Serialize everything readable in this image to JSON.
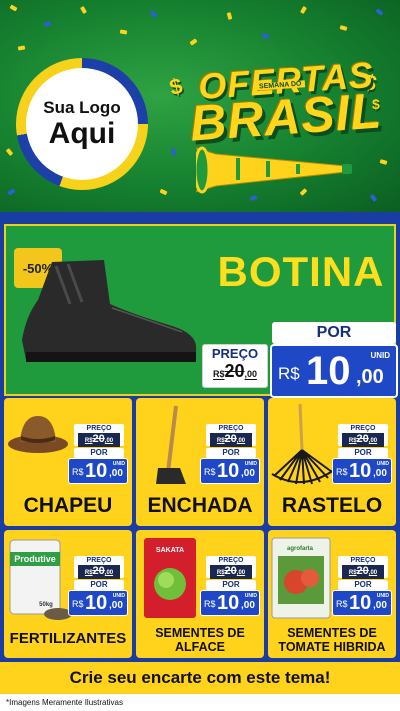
{
  "header": {
    "logo_line1": "Sua Logo",
    "logo_line2": "Aqui",
    "title_top": "OFERTAS",
    "title_small": "SEMANA DO",
    "title_bottom": "BRASIL",
    "dollar_sign": "$"
  },
  "featured": {
    "discount_badge": "-50%",
    "name": "BOTINA",
    "old_price_label": "PREÇO",
    "old_price_currency": "R$",
    "old_price_int": "20",
    "old_price_dec": ",00",
    "new_price_label": "POR",
    "new_price_currency": "R$",
    "new_price_int": "10",
    "new_price_dec": ",00",
    "unit": "UNID"
  },
  "products": [
    {
      "name": "CHAPEU",
      "old_label": "PREÇO",
      "old_currency": "R$",
      "old_int": "20",
      "old_dec": ",00",
      "new_label": "POR",
      "currency": "R$",
      "int": "10",
      "dec": ",00",
      "unit": "UNID"
    },
    {
      "name": "ENCHADA",
      "old_label": "PREÇO",
      "old_currency": "R$",
      "old_int": "20",
      "old_dec": ",00",
      "new_label": "POR",
      "currency": "R$",
      "int": "10",
      "dec": ",00",
      "unit": "UNID"
    },
    {
      "name": "RASTELO",
      "old_label": "PREÇO",
      "old_currency": "R$",
      "old_int": "20",
      "old_dec": ",00",
      "new_label": "POR",
      "currency": "R$",
      "int": "10",
      "dec": ",00",
      "unit": "UNID"
    },
    {
      "name": "FERTILIZANTES",
      "old_label": "PREÇO",
      "old_currency": "R$",
      "old_int": "20",
      "old_dec": ",00",
      "new_label": "POR",
      "currency": "R$",
      "int": "10",
      "dec": ",00",
      "unit": "UNID"
    },
    {
      "name_line1": "SEMENTES DE",
      "name_line2": "ALFACE",
      "old_label": "PREÇO",
      "old_currency": "R$",
      "old_int": "20",
      "old_dec": ",00",
      "new_label": "POR",
      "currency": "R$",
      "int": "10",
      "dec": ",00",
      "unit": "UNID"
    },
    {
      "name_line1": "SEMENTES DE",
      "name_line2": "TOMATE HIBRIDA",
      "old_label": "PREÇO",
      "old_currency": "R$",
      "old_int": "20",
      "old_dec": ",00",
      "new_label": "POR",
      "currency": "R$",
      "int": "10",
      "dec": ",00",
      "unit": "UNID"
    }
  ],
  "packaging": {
    "fertilizer_brand": "Produtive",
    "fertilizer_weight": "50kg",
    "lettuce_brand": "SAKATA",
    "tomato_brand": "agrofarta"
  },
  "footer": {
    "cta": "Crie seu encarte com este tema!",
    "disclaimer": "*Imagens Meramente Ilustrativas"
  },
  "colors": {
    "brand_green": "#1f9a3c",
    "brand_yellow": "#ffd21c",
    "brand_blue": "#1a3da3",
    "price_blue": "#1e48c6"
  }
}
